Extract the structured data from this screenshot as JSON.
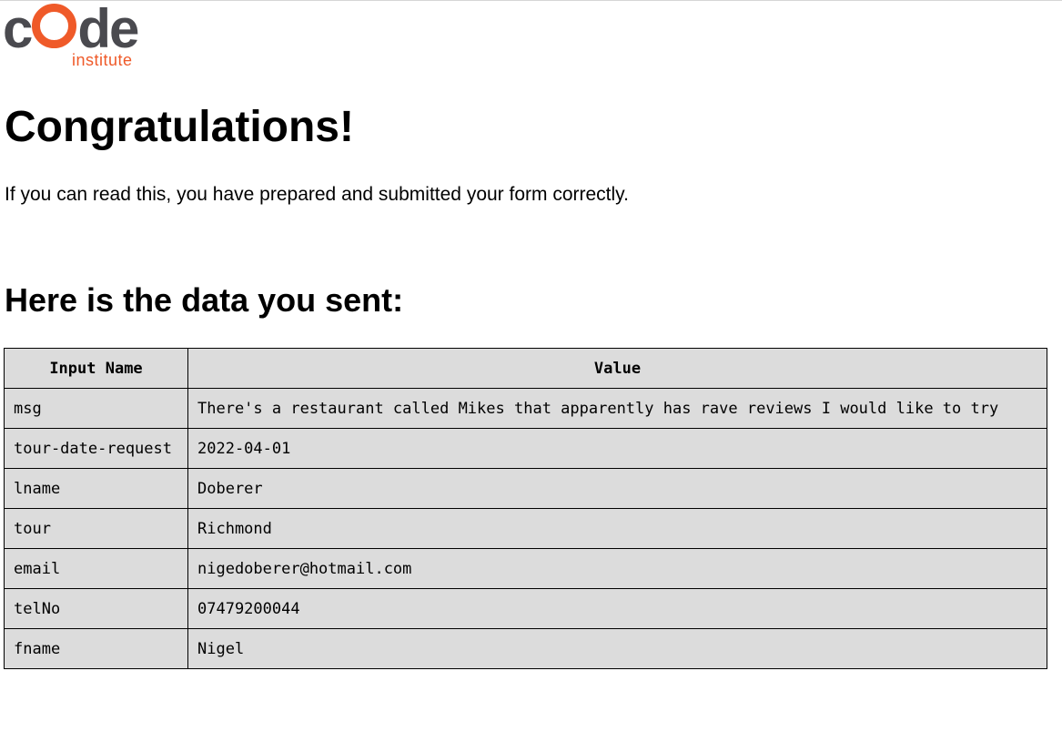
{
  "logo": {
    "word_prefix": "c",
    "word_suffix": "de",
    "sub": "institute",
    "colors": {
      "dark": "#4a4a4f",
      "accent": "#ef5a29"
    }
  },
  "title": "Congratulations!",
  "intro": "If you can read this, you have prepared and submitted your form correctly.",
  "subtitle": "Here is the data you sent:",
  "table": {
    "headers": [
      "Input Name",
      "Value"
    ],
    "rows": [
      [
        "msg",
        "There's a restaurant called Mikes that apparently has rave reviews I would like to try"
      ],
      [
        "tour-date-request",
        "2022-04-01"
      ],
      [
        "lname",
        "Doberer"
      ],
      [
        "tour",
        "Richmond"
      ],
      [
        "email",
        "nigedoberer@hotmail.com"
      ],
      [
        "telNo",
        "07479200044"
      ],
      [
        "fname",
        "Nigel"
      ]
    ],
    "background": "#dcdcdc"
  }
}
